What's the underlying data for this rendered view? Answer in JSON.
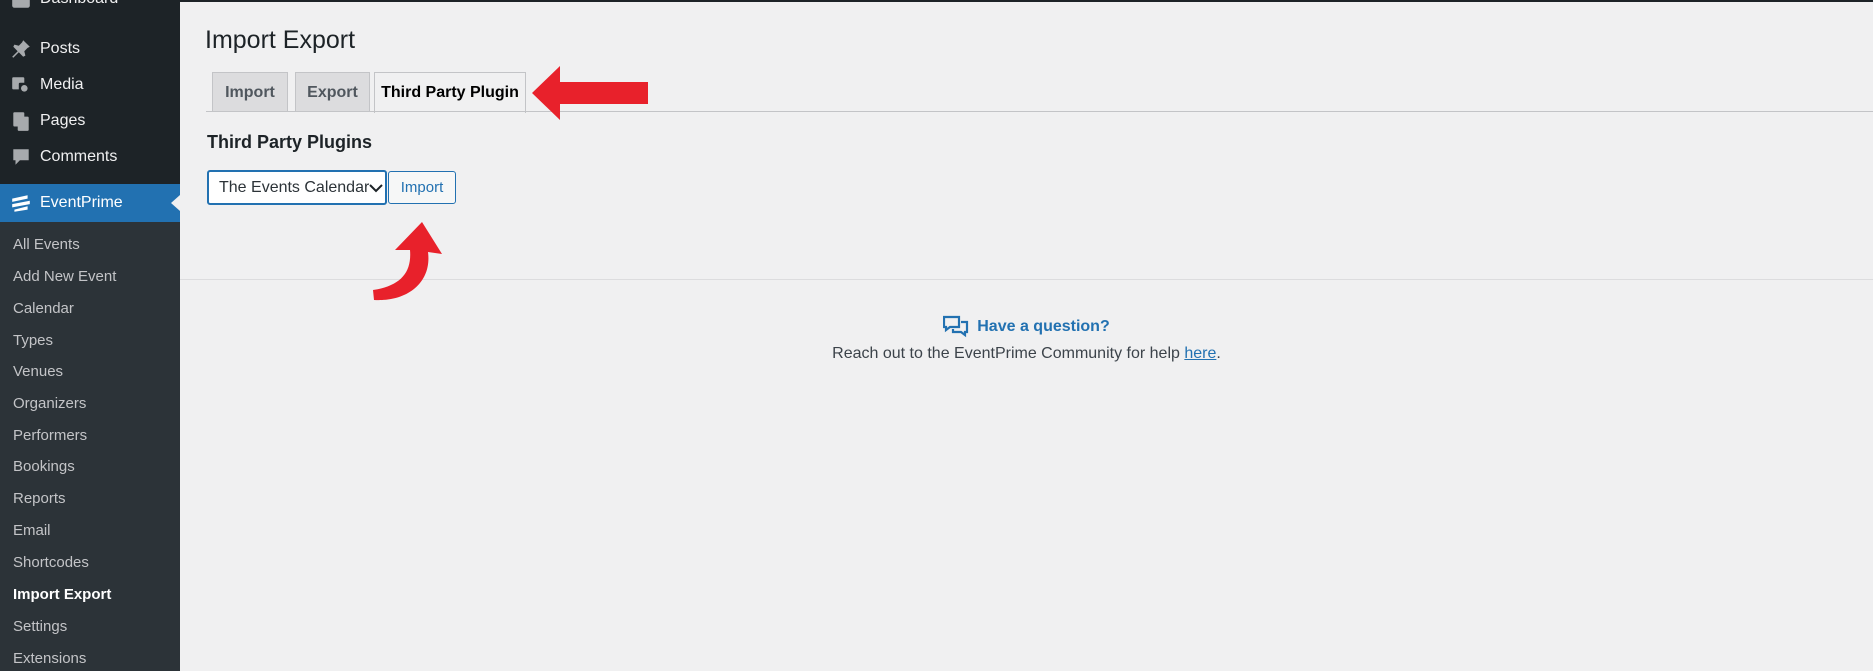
{
  "sidebar": {
    "top_items": [
      {
        "label": "Dashboard",
        "icon": "dashboard-icon"
      },
      {
        "label": "Posts",
        "icon": "pushpin-icon"
      },
      {
        "label": "Media",
        "icon": "media-icon"
      },
      {
        "label": "Pages",
        "icon": "pages-icon"
      },
      {
        "label": "Comments",
        "icon": "comment-icon"
      },
      {
        "label": "EventPrime",
        "icon": "eventprime-icon"
      }
    ],
    "submenu": [
      "All Events",
      "Add New Event",
      "Calendar",
      "Types",
      "Venues",
      "Organizers",
      "Performers",
      "Bookings",
      "Reports",
      "Email",
      "Shortcodes",
      "Import Export",
      "Settings",
      "Extensions"
    ],
    "current_submenu": "Import Export"
  },
  "page": {
    "title": "Import Export",
    "tabs": [
      {
        "label": "Import",
        "active": false
      },
      {
        "label": "Export",
        "active": false
      },
      {
        "label": "Third Party Plugin",
        "active": true
      }
    ],
    "section_title": "Third Party Plugins",
    "plugin_select": {
      "value": "The Events Calendar"
    },
    "import_button": "Import"
  },
  "help": {
    "title": "Have a question?",
    "text_before": "Reach out to the EventPrime Community for help ",
    "link_text": "here",
    "text_after": "."
  },
  "colors": {
    "sidebar_bg": "#1d2327",
    "submenu_bg": "#2c3338",
    "accent": "#2271b1",
    "annotation_red": "#e8212b"
  }
}
